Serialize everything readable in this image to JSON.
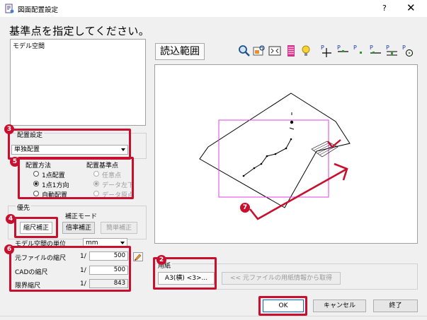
{
  "window": {
    "title": "図面配置設定",
    "help": "?",
    "close": "✕"
  },
  "instruction": "基準点を指定してください。",
  "space_list": {
    "items": [
      "モデル空間"
    ]
  },
  "placement_setting": {
    "label": "配置設定",
    "value": "単独配置",
    "badge": "3"
  },
  "placement_method": {
    "label": "配置方法",
    "badge": "5",
    "options": [
      {
        "label": "1点配置",
        "checked": false
      },
      {
        "label": "1点1方向",
        "checked": true
      },
      {
        "label": "自動配置",
        "checked": false
      }
    ]
  },
  "base_point": {
    "label": "配置基準点",
    "options": [
      {
        "label": "任意点",
        "checked": false
      },
      {
        "label": "データ左下",
        "checked": true
      },
      {
        "label": "データ原点",
        "checked": false
      }
    ]
  },
  "priority": {
    "label": "優先",
    "correction_mode_label": "補正モード",
    "badge": "4",
    "buttons": {
      "scale_correction": "縮尺補正",
      "ratio_correction": "倍率補正",
      "simple_correction": "簡単補正"
    }
  },
  "model_space_unit": {
    "label": "モデル空間の単位",
    "value": "mm",
    "badge": "6"
  },
  "scales": {
    "rows": [
      {
        "label": "元ファイルの縮尺",
        "prefix": "1/",
        "value": "500"
      },
      {
        "label": "CADの縮尺",
        "prefix": "1/",
        "value": "500"
      },
      {
        "label": "限界縮尺",
        "prefix": "1/",
        "value": "843"
      }
    ]
  },
  "toolbar": {
    "load_range": "読込範囲",
    "icons": [
      "zoom-icon",
      "zoom-window-icon",
      "zoom-extents-icon",
      "layer-icon",
      "bulb-icon",
      "point-cross-icon",
      "point-top-icon",
      "point-right-icon",
      "point-left-icon",
      "point-bottom-icon",
      "point-circle-icon"
    ],
    "point_icon_letter": "P"
  },
  "paper": {
    "label": "用紙",
    "badge": "2",
    "size_button": "A3(横) <3>...",
    "get_from_source_button": "<< 元ファイルの用紙情報から取得"
  },
  "preview": {
    "badge": "7"
  },
  "footer": {
    "ok": "OK",
    "cancel": "キャンセル",
    "close": "終了"
  },
  "colors": {
    "highlight_red": "#c8102e",
    "paper_magenta": "#e040e0"
  }
}
